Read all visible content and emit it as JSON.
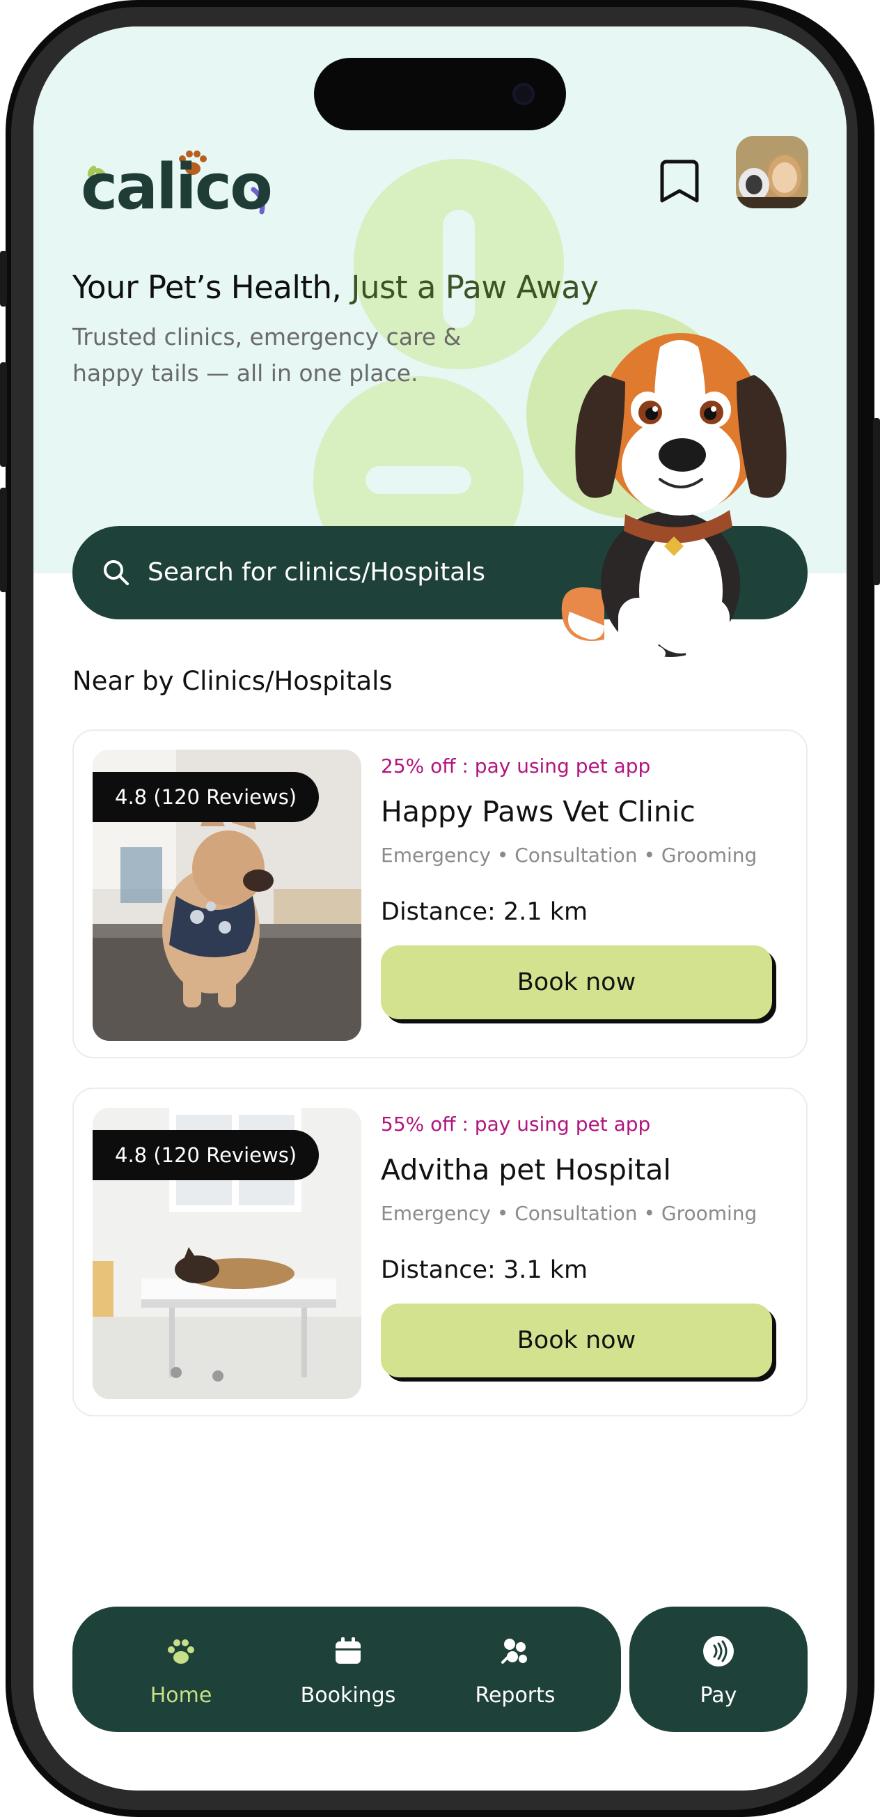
{
  "header": {
    "logo_text": "calico",
    "bookmark_icon": "bookmark-icon",
    "avatar_icon": "user-avatar"
  },
  "hero": {
    "title_part1": "Your Pet’s Health, ",
    "title_part2": "Just a Paw Away",
    "subtitle": "Trusted clinics, emergency care & happy tails — all in one place."
  },
  "search": {
    "placeholder": "Search for clinics/Hospitals",
    "icon": "search-icon"
  },
  "section": {
    "title": "Near by Clinics/Hospitals"
  },
  "clinics": [
    {
      "rating": "4.8 (120 Reviews)",
      "offer": "25% off : pay using pet app",
      "name": "Happy Paws Vet Clinic",
      "services": "Emergency • Consultation • Grooming",
      "distance": "Distance: 2.1 km",
      "cta": "Book now"
    },
    {
      "rating": "4.8 (120 Reviews)",
      "offer": "55% off : pay using pet app",
      "name": "Advitha pet Hospital",
      "services": "Emergency • Consultation • Grooming",
      "distance": "Distance: 3.1 km",
      "cta": "Book now"
    }
  ],
  "bottom_nav": {
    "items": [
      {
        "label": "Home",
        "icon": "paw-icon",
        "active": true
      },
      {
        "label": "Bookings",
        "icon": "calendar-icon",
        "active": false
      },
      {
        "label": "Reports",
        "icon": "reports-icon",
        "active": false
      }
    ],
    "pay": {
      "label": "Pay",
      "icon": "contactless-pay-icon"
    }
  },
  "colors": {
    "primary_dark": "#1e413a",
    "accent_lime": "#d2e28e",
    "hero_bg": "#e6f7f4",
    "offer_magenta": "#b0157e",
    "active_nav": "#c7df86"
  }
}
